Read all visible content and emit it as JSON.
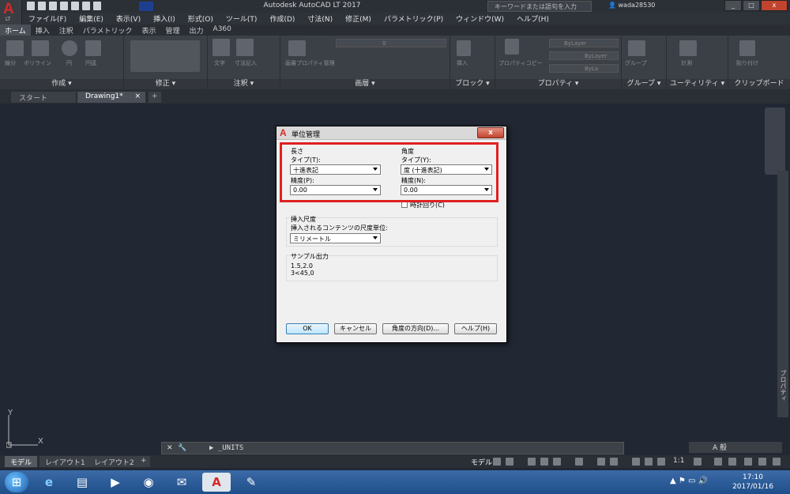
{
  "app": {
    "title": "Autodesk AutoCAD LT 2017",
    "logo_letter": "A",
    "logo_sub": "LT",
    "search_placeholder": "キーワードまたは語句を入力",
    "user": "wada28530",
    "win_min": "_",
    "win_max": "□",
    "win_close": "x"
  },
  "menubar": [
    "ファイル(F)",
    "編集(E)",
    "表示(V)",
    "挿入(I)",
    "形式(O)",
    "ツール(T)",
    "作成(D)",
    "寸法(N)",
    "修正(M)",
    "パラメトリック(P)",
    "ウィンドウ(W)",
    "ヘルプ(H)"
  ],
  "ribbon_tabs": [
    "ホーム",
    "挿入",
    "注釈",
    "パラメトリック",
    "表示",
    "管理",
    "出力",
    "A360"
  ],
  "ribbon_panels": {
    "create": "作成 ▾",
    "modify": "修正 ▾",
    "annotation": "注釈 ▾",
    "layer": "画層 ▾",
    "block": "ブロック ▾",
    "properties": "プロパティ ▾",
    "group": "グループ ▾",
    "utility": "ユーティリティ ▾",
    "clipboard": "クリップボード"
  },
  "ribbon_labels": {
    "line": "線分",
    "polyline": "ポリライン",
    "circle": "円",
    "arc": "円弧",
    "text": "文字",
    "dimension": "寸法記入",
    "layer_props": "画層プロパティ管理",
    "layer_value": "0",
    "insert": "挿入",
    "props_copy": "プロパティコピー",
    "bylayer1": "ByLayer",
    "bylayer2": "ByLayer",
    "bylayer3": "ByLa",
    "group": "グループ",
    "measure": "計測",
    "paste": "貼り付け"
  },
  "doc_tabs": {
    "start": "スタート",
    "drawing": "Drawing1*",
    "close": "×",
    "add": "+"
  },
  "ucs": {
    "x": "X",
    "y": "Y"
  },
  "palette_label": "プロパティ",
  "command_line": "▶ _UNITS",
  "layout_tabs": [
    "モデル",
    "レイアウト1",
    "レイアウト2",
    "+"
  ],
  "status": {
    "model": "モデル",
    "scale": "1:1"
  },
  "notify": "A 般",
  "clock": {
    "time": "17:10",
    "date": "2017/01/16"
  },
  "dialog": {
    "title": "単位管理",
    "close": "x",
    "length": {
      "heading": "長さ",
      "type_label": "タイプ(T):",
      "type_value": "十進表記",
      "precision_label": "精度(P):",
      "precision_value": "0.00"
    },
    "angle": {
      "heading": "角度",
      "type_label": "タイプ(Y):",
      "type_value": "度 (十進表記)",
      "precision_label": "精度(N):",
      "precision_value": "0.00",
      "clockwise_label": "時計回り(C)"
    },
    "insertion": {
      "heading": "挿入尺度",
      "label": "挿入されるコンテンツの尺度単位:",
      "value": "ミリメートル"
    },
    "sample": {
      "heading": "サンプル出力",
      "line1": "1.5,2.0",
      "line2": "3<45,0"
    },
    "buttons": {
      "ok": "OK",
      "cancel": "キャンセル",
      "direction": "角度の方向(D)...",
      "help": "ヘルプ(H)"
    }
  }
}
